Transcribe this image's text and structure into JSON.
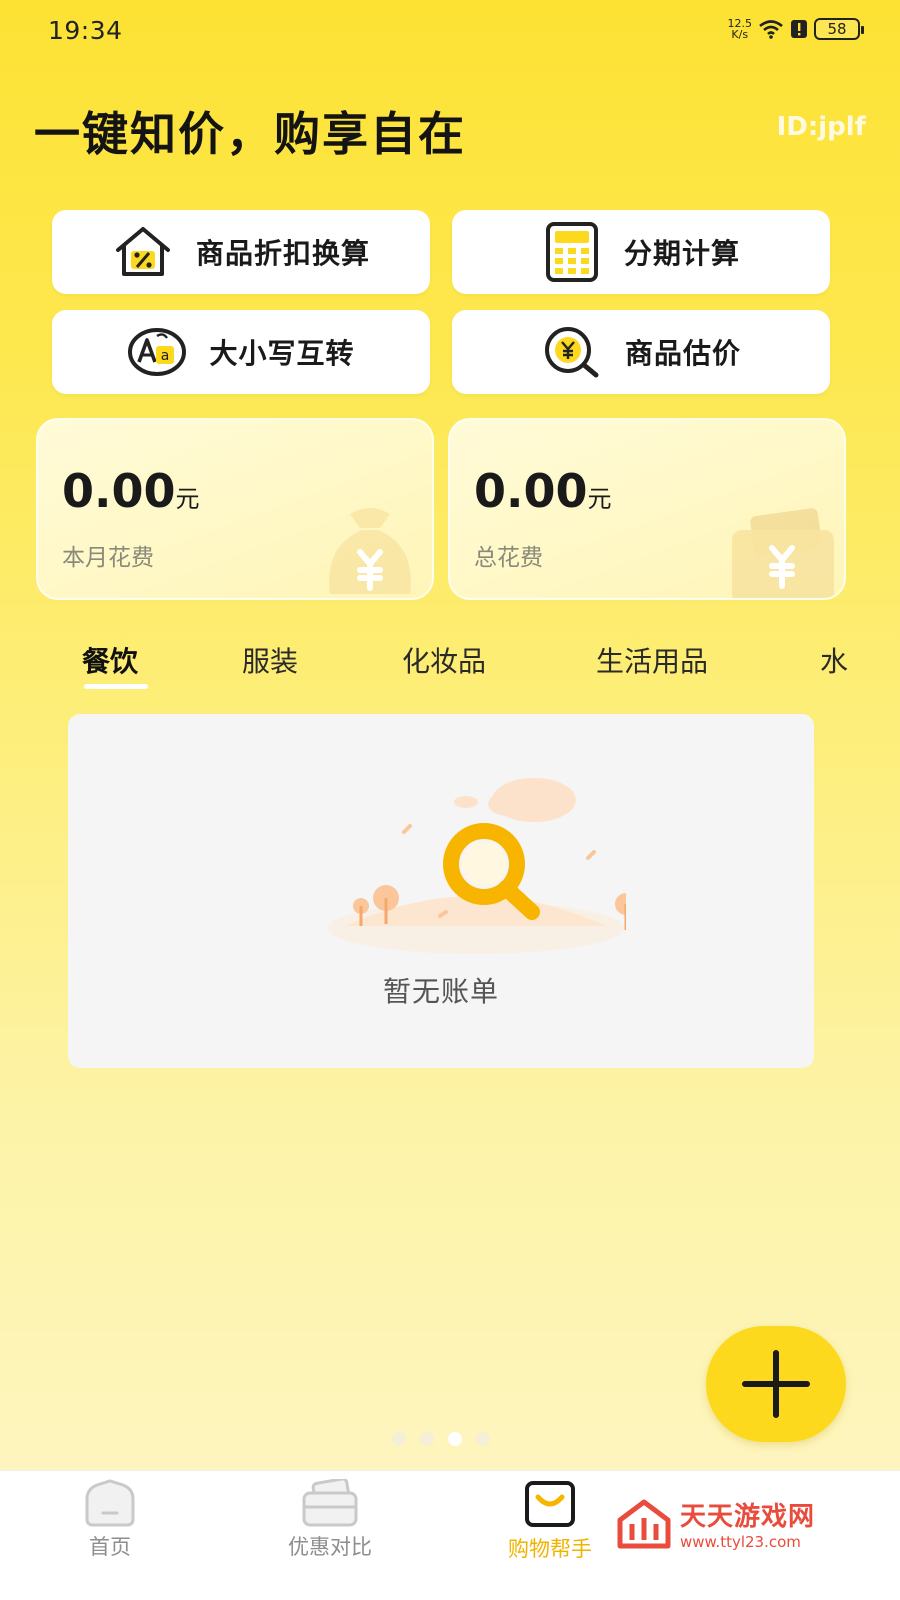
{
  "status": {
    "time": "19:34",
    "net_speed_value": "12.5",
    "net_speed_unit": "K/s",
    "battery": "58"
  },
  "header": {
    "headline": "一键知价，购享自在",
    "user_id": "ID:jplf"
  },
  "tools": [
    {
      "label": "商品折扣换算",
      "icon": "discount-house-icon"
    },
    {
      "label": "分期计算",
      "icon": "calculator-icon"
    },
    {
      "label": "大小写互转",
      "icon": "case-convert-icon"
    },
    {
      "label": "商品估价",
      "icon": "price-search-icon"
    }
  ],
  "stats": [
    {
      "value": "0.00",
      "unit": "元",
      "label": "本月花费",
      "icon": "money-bag-icon"
    },
    {
      "value": "0.00",
      "unit": "元",
      "label": "总花费",
      "icon": "wallet-icon"
    }
  ],
  "categories": [
    "餐饮",
    "服装",
    "化妆品",
    "生活用品",
    "水"
  ],
  "active_category": "餐饮",
  "empty": {
    "text": "暂无账单",
    "icon": "empty-search-illustration"
  },
  "fab": {
    "icon": "plus-icon"
  },
  "pager": {
    "count": 4,
    "active_index": 2
  },
  "nav": [
    {
      "label": "首页",
      "icon": "home-icon"
    },
    {
      "label": "优惠对比",
      "icon": "coupon-compare-icon"
    },
    {
      "label": "购物帮手",
      "icon": "shopping-bag-icon",
      "active": true
    }
  ],
  "watermark": {
    "title": "天天游戏网",
    "url": "www.ttyl23.com"
  },
  "colors": {
    "accent": "#fcd91c",
    "active_nav": "#f0b400",
    "background_top": "#fde234"
  }
}
